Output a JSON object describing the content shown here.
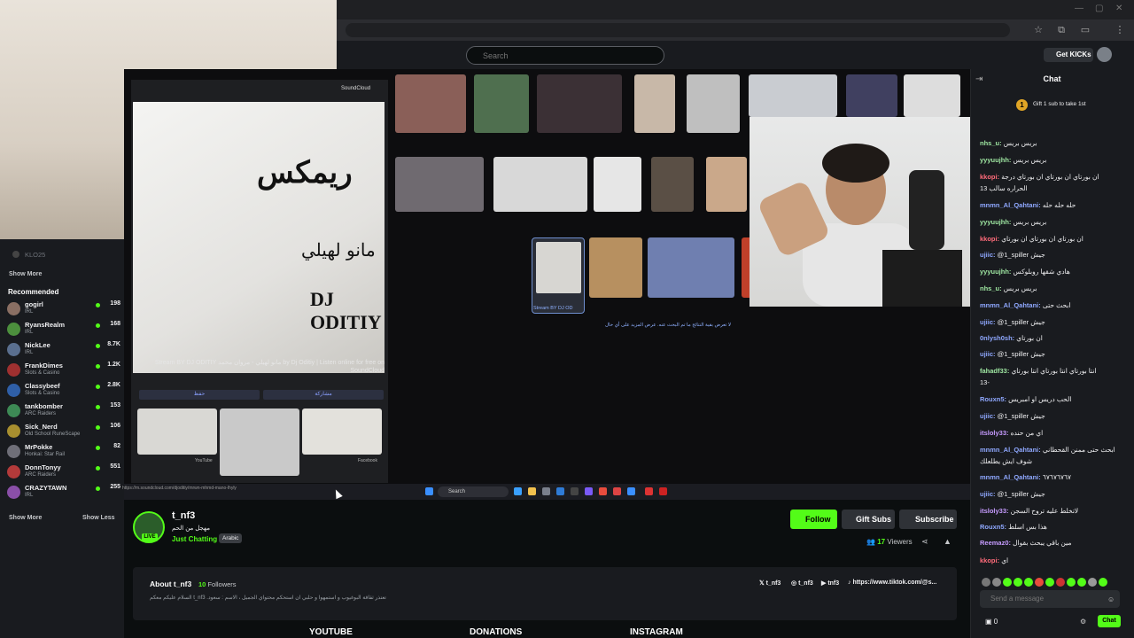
{
  "header": {
    "search_placeholder": "Search",
    "get_kicks": "Get KICKs"
  },
  "sidebar": {
    "top_channel": "KLO25",
    "show_more_top": "Show More",
    "recommended_title": "Recommended",
    "channels": [
      {
        "name": "gogirl",
        "category": "IRL",
        "viewers": "198",
        "color": "#8a6f63"
      },
      {
        "name": "RyansRealm",
        "category": "IRL",
        "viewers": "168",
        "color": "#4c8f3d"
      },
      {
        "name": "NickLee",
        "category": "IRL",
        "viewers": "8.7K",
        "color": "#5a6f8f"
      },
      {
        "name": "FrankDimes",
        "category": "Slots & Casino",
        "viewers": "1.2K",
        "color": "#9f3030"
      },
      {
        "name": "Classybeef",
        "category": "Slots & Casino",
        "viewers": "2.8K",
        "color": "#2f5fa8"
      },
      {
        "name": "tankbomber",
        "category": "ARC Raiders",
        "viewers": "153",
        "color": "#3d8a55"
      },
      {
        "name": "Sick_Nerd",
        "category": "Old School RuneScape",
        "viewers": "106",
        "color": "#a88f2f"
      },
      {
        "name": "MrPokke",
        "category": "Honkai: Star Rail",
        "viewers": "82",
        "color": "#6f6f78"
      },
      {
        "name": "DonnTonyy",
        "category": "ARC Raiders",
        "viewers": "551",
        "color": "#b33a3a"
      },
      {
        "name": "CRAZYTAWN",
        "category": "IRL",
        "viewers": "255",
        "color": "#8a4fa8"
      }
    ],
    "show_more": "Show More",
    "show_less": "Show Less"
  },
  "stream": {
    "soundcloud_label": "SoundCloud",
    "art_title": "ريمكس",
    "art_subtitle": "مانو لهيلي",
    "art_artist": "DJ ODITIY",
    "result_title": "Stream BY DJ ODITIY مانو لهيلي - مروان محمد by Dj Oditiy | Listen online for free on SoundCloud",
    "btn_left": "حفظ",
    "btn_right": "مشاركة",
    "grid_label": "Stream BY DJ OD",
    "more_results": "لا تعرض بقية النتائج ما تم البحث عنه. عرض المزيد على أي حال",
    "taskbar_search": "Search",
    "status_url": "https://m.soundcloud.com/djoditiy/mrwn-mhmd-mano-lhyly",
    "bottom_captions": [
      "YouTube",
      "Facebook"
    ]
  },
  "channel": {
    "name": "t_nf3",
    "title": "مهجل من الحم",
    "category": "Just Chatting",
    "language": "Arabic",
    "follow": "Follow",
    "gift_subs": "Gift Subs",
    "subscribe": "Subscribe",
    "viewers_count": "17",
    "viewers_label": "Viewers"
  },
  "about": {
    "title": "About t_nf3",
    "followers_count": "10",
    "followers_label": "Followers",
    "bio": "السلام عليكم معكم t_nf3 .تعتذر ثقاقة البوغيوب و استمهوا و حلبي ان استحكم محتواي الجميل ، الاسم : سعود",
    "socials": [
      "t_nf3",
      "t_nf3",
      "tnf3",
      "https://www.tiktok.com/@s..."
    ],
    "panels": [
      "YOUTUBE",
      "DONATIONS",
      "INSTAGRAM"
    ]
  },
  "chat": {
    "title": "Chat",
    "gift_num": "1",
    "gift_text": "Gift 1 sub to take 1st",
    "messages": [
      {
        "user": "nhs_u:",
        "color": "#9ee6a1",
        "text": "بريس بريس"
      },
      {
        "user": "yyyuujhh:",
        "color": "#9ee6a1",
        "text": "بريس بريس"
      },
      {
        "user": "kkopi:",
        "color": "#ff6b7a",
        "text": "ان بورتاي ان بورتاي ان بورتاي درجة"
      },
      {
        "user": "",
        "color": "#efeff1",
        "text": "الحراره سالب 13"
      },
      {
        "user": "mnmn_Al_Qahtani:",
        "color": "#8fa8ff",
        "text": "حله حله حله"
      },
      {
        "user": "yyyuujhh:",
        "color": "#9ee6a1",
        "text": "بريس بريس"
      },
      {
        "user": "kkopi:",
        "color": "#ff6b7a",
        "text": "ان بورتاي ان بورتاي ان بورتاي"
      },
      {
        "user": "ujiic:",
        "color": "#8fa8ff",
        "text": "@1_spiller جيش"
      },
      {
        "user": "yyyuujhh:",
        "color": "#9ee6a1",
        "text": "هادي شقها روبلوكس"
      },
      {
        "user": "nhs_u:",
        "color": "#9ee6a1",
        "text": "بريس بريس"
      },
      {
        "user": "mnmn_Al_Qahtani:",
        "color": "#8fa8ff",
        "text": "ابحث حتى"
      },
      {
        "user": "ujiic:",
        "color": "#8fa8ff",
        "text": "@1_spiller جيش"
      },
      {
        "user": "0nlysh0sh:",
        "color": "#8fa8ff",
        "text": "ان بورتاي"
      },
      {
        "user": "ujiic:",
        "color": "#8fa8ff",
        "text": "@1_spiller جيش"
      },
      {
        "user": "fahadf33:",
        "color": "#9ee6a1",
        "text": "انتا بورتاي انتا بورتاي انتا بورتاي"
      },
      {
        "user": "",
        "color": "#efeff1",
        "text": "13-"
      },
      {
        "user": "Rouxn5:",
        "color": "#8fa8ff",
        "text": "الحب دريس او امبريس"
      },
      {
        "user": "ujiic:",
        "color": "#8fa8ff",
        "text": "@1_spiller جيش"
      },
      {
        "user": "itsloly33:",
        "color": "#c69bff",
        "text": "اي من حنده"
      },
      {
        "user": "mnmn_Al_Qahtani:",
        "color": "#8fa8ff",
        "text": "ابحث حتى ممنن القحطاني"
      },
      {
        "user": "",
        "color": "#efeff1",
        "text": "شوف ايش يطلعلك"
      },
      {
        "user": "mnmn_Al_Qahtani:",
        "color": "#8fa8ff",
        "text": "٦٧٦٧٦٧٦٧"
      },
      {
        "user": "ujiic:",
        "color": "#8fa8ff",
        "text": "@1_spiller جيش"
      },
      {
        "user": "itsloly33:",
        "color": "#c69bff",
        "text": "لاتخلط عليه تروح السجن"
      },
      {
        "user": "Rouxn5:",
        "color": "#8fa8ff",
        "text": "هذا بس اسلط"
      },
      {
        "user": "Reemaz0:",
        "color": "#c69bff",
        "text": "مين باقي يبحث بقوال"
      },
      {
        "user": "kkopi:",
        "color": "#ff6b7a",
        "text": "اي"
      }
    ],
    "input_placeholder": "Send a message",
    "kicks_count": "0",
    "send_label": "Chat"
  }
}
